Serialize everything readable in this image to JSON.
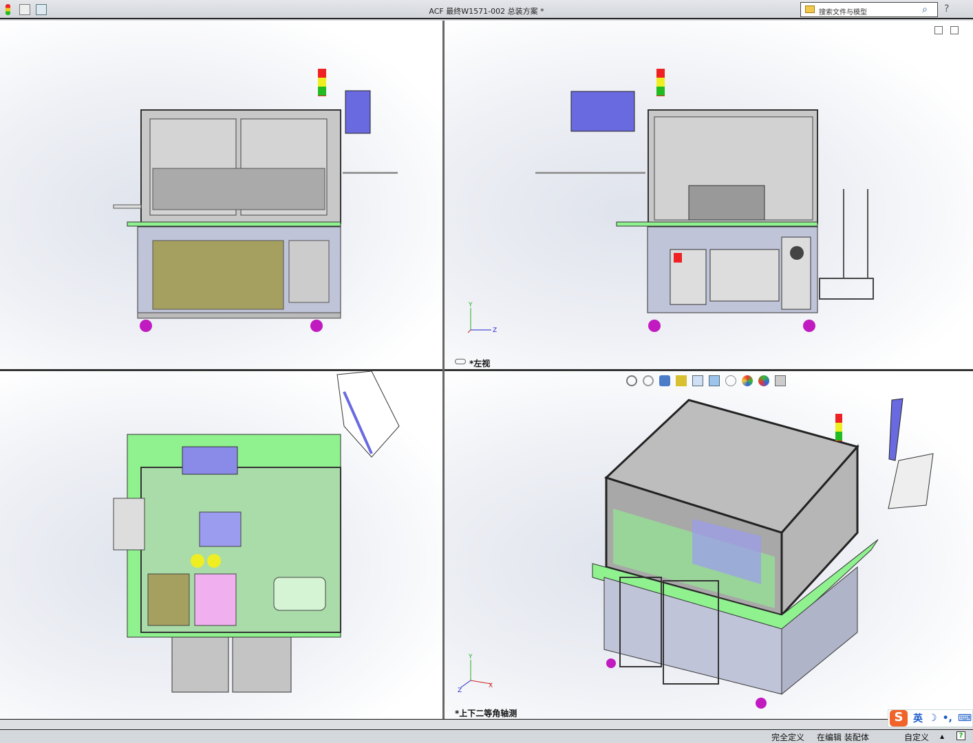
{
  "titlebar": {
    "title": "ACF 最终W1571-002 总装方案 *",
    "search_placeholder": "搜索文件与模型",
    "icons": [
      "traffic-light-icon",
      "file-properties-icon",
      "options-icon",
      "search-icon",
      "help-icon"
    ]
  },
  "viewports": [
    {
      "id": "front",
      "label": ""
    },
    {
      "id": "left",
      "label": "*左视"
    },
    {
      "id": "top",
      "label": ""
    },
    {
      "id": "trimetric",
      "label": "*上下二等角轴测"
    }
  ],
  "axes": {
    "y": "Y",
    "z": "Z",
    "x": "X"
  },
  "heads_up_toolbar": [
    "zoom-to-fit-icon",
    "zoom-area-icon",
    "previous-view-icon",
    "section-view-icon",
    "view-orientation-icon",
    "display-style-icon",
    "hide-show-icon",
    "edit-appearance-icon",
    "apply-scene-icon",
    "view-settings-icon"
  ],
  "status": {
    "definition": "完全定义",
    "editing": "在编辑 装配体",
    "units": "自定义",
    "up_arrow": "▲",
    "help": "?"
  },
  "ime": {
    "brand": "S",
    "mode": "英",
    "moon": "☽",
    "punct": "•,",
    "keyboard": "⌨"
  },
  "colors": {
    "frame": "#9aa0b4",
    "green": "#8ff28f",
    "blue": "#6a6ae0",
    "magenta": "#c01ac0",
    "glass": "#bdbdbd"
  }
}
